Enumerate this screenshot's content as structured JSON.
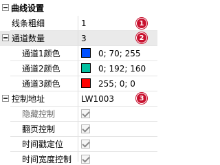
{
  "grid": {
    "section_curve": {
      "label": "曲线设置"
    },
    "line_width": {
      "label": "线条粗细",
      "value": "1"
    },
    "channel_count": {
      "label": "通道数量",
      "value": "3"
    },
    "channels": [
      {
        "label": "通道1颜色",
        "color": "#0050ff",
        "value": "0; 70; 255"
      },
      {
        "label": "通道2颜色",
        "color": "#00c0a0",
        "value": "0; 192; 160"
      },
      {
        "label": "通道3颜色",
        "color": "#ff0000",
        "value": "255; 0; 0"
      }
    ],
    "control_address": {
      "label": "控制地址",
      "value": "LW1003"
    },
    "options": [
      {
        "label": "隐藏控制",
        "checked": true,
        "disabled": true
      },
      {
        "label": "翻页控制",
        "checked": true,
        "disabled": false
      },
      {
        "label": "时间戳定位",
        "checked": true,
        "disabled": false
      },
      {
        "label": "时间宽度控制",
        "checked": true,
        "disabled": false
      }
    ]
  },
  "badges": [
    "1",
    "2",
    "3"
  ]
}
